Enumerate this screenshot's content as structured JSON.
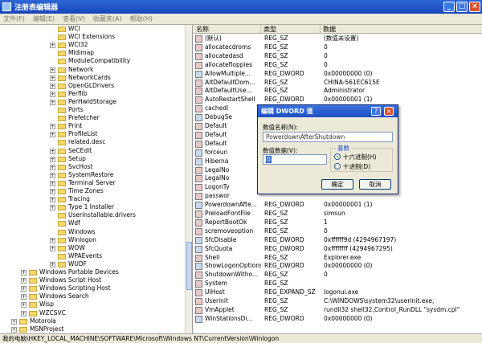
{
  "window": {
    "title": "注册表编辑器"
  },
  "menu": [
    "文件(F)",
    "编辑(E)",
    "查看(V)",
    "收藏夹(A)",
    "帮助(H)"
  ],
  "tree": [
    {
      "label": "WCI",
      "indent": 6,
      "exp": ""
    },
    {
      "label": "WCI Extensions",
      "indent": 6,
      "exp": ""
    },
    {
      "label": "WCI32",
      "indent": 6,
      "exp": "+"
    },
    {
      "label": "Midimap",
      "indent": 6,
      "exp": ""
    },
    {
      "label": "ModuleCompatibility",
      "indent": 6,
      "exp": ""
    },
    {
      "label": "Network",
      "indent": 6,
      "exp": "+"
    },
    {
      "label": "NetworkCards",
      "indent": 6,
      "exp": "+"
    },
    {
      "label": "OpenGLDrivers",
      "indent": 6,
      "exp": "+"
    },
    {
      "label": "Perflib",
      "indent": 6,
      "exp": "+"
    },
    {
      "label": "PerHwIdStorage",
      "indent": 6,
      "exp": "+"
    },
    {
      "label": "Ports",
      "indent": 6,
      "exp": ""
    },
    {
      "label": "Prefetcher",
      "indent": 6,
      "exp": ""
    },
    {
      "label": "Print",
      "indent": 6,
      "exp": "+"
    },
    {
      "label": "ProfileList",
      "indent": 6,
      "exp": "+"
    },
    {
      "label": "related.desc",
      "indent": 6,
      "exp": ""
    },
    {
      "label": "SeCEdit",
      "indent": 6,
      "exp": "+"
    },
    {
      "label": "Setup",
      "indent": 6,
      "exp": "+"
    },
    {
      "label": "SvcHost",
      "indent": 6,
      "exp": "+"
    },
    {
      "label": "SystemRestore",
      "indent": 6,
      "exp": "+"
    },
    {
      "label": "Terminal Server",
      "indent": 6,
      "exp": "+"
    },
    {
      "label": "Time Zones",
      "indent": 6,
      "exp": "+"
    },
    {
      "label": "Tracing",
      "indent": 6,
      "exp": "+"
    },
    {
      "label": "Type 1 Installer",
      "indent": 6,
      "exp": "+"
    },
    {
      "label": "Userinstallable.drivers",
      "indent": 6,
      "exp": ""
    },
    {
      "label": "Wdf",
      "indent": 6,
      "exp": ""
    },
    {
      "label": "Windows",
      "indent": 6,
      "exp": ""
    },
    {
      "label": "Winlogon",
      "indent": 6,
      "exp": "+"
    },
    {
      "label": "WOW",
      "indent": 6,
      "exp": "+"
    },
    {
      "label": "WPAEvents",
      "indent": 6,
      "exp": ""
    },
    {
      "label": "WUDF",
      "indent": 6,
      "exp": "+"
    },
    {
      "label": "Windows Portable Devices",
      "indent": 3,
      "exp": "+"
    },
    {
      "label": "Windows Script Host",
      "indent": 3,
      "exp": "+"
    },
    {
      "label": "Windows Scripting Host",
      "indent": 3,
      "exp": "+"
    },
    {
      "label": "Windows Search",
      "indent": 3,
      "exp": "+"
    },
    {
      "label": "Wisp",
      "indent": 3,
      "exp": "+"
    },
    {
      "label": "WZCSVC",
      "indent": 3,
      "exp": "+"
    },
    {
      "label": "Motorola",
      "indent": 2,
      "exp": "+"
    },
    {
      "label": "MSNProject",
      "indent": 2,
      "exp": "+"
    }
  ],
  "list_headers": [
    "名称",
    "类型",
    "数据"
  ],
  "values": [
    {
      "icon": "ab",
      "name": "(默认)",
      "type": "REG_SZ",
      "data": "(数值未设置)"
    },
    {
      "icon": "ab",
      "name": "allocatecdroms",
      "type": "REG_SZ",
      "data": "0"
    },
    {
      "icon": "ab",
      "name": "allocatedasd",
      "type": "REG_SZ",
      "data": "0"
    },
    {
      "icon": "ab",
      "name": "allocatefloppies",
      "type": "REG_SZ",
      "data": "0"
    },
    {
      "icon": "bin",
      "name": "AllowMultiple...",
      "type": "REG_DWORD",
      "data": "0x00000000 (0)"
    },
    {
      "icon": "ab",
      "name": "AltDefaultDom...",
      "type": "REG_SZ",
      "data": "CHINA-561EC615E"
    },
    {
      "icon": "ab",
      "name": "AltDefaultUse...",
      "type": "REG_SZ",
      "data": "Administrator"
    },
    {
      "icon": "ab",
      "name": "AutoRestartShell",
      "type": "REG_DWORD",
      "data": "0x00000001 (1)"
    },
    {
      "icon": "ab",
      "name": "cachedl",
      "type": "",
      "data": ""
    },
    {
      "icon": "bin",
      "name": "DebugSe",
      "type": "",
      "data": ""
    },
    {
      "icon": "ab",
      "name": "Default",
      "type": "",
      "data": ""
    },
    {
      "icon": "ab",
      "name": "Default",
      "type": "",
      "data": ""
    },
    {
      "icon": "ab",
      "name": "Default",
      "type": "",
      "data": ""
    },
    {
      "icon": "bin",
      "name": "forceun",
      "type": "",
      "data": ""
    },
    {
      "icon": "bin",
      "name": "Hiberna",
      "type": "",
      "data": ""
    },
    {
      "icon": "ab",
      "name": "LegalNo",
      "type": "",
      "data": ""
    },
    {
      "icon": "ab",
      "name": "LegalNo",
      "type": "",
      "data": ""
    },
    {
      "icon": "ab",
      "name": "LogonTy",
      "type": "",
      "data": ""
    },
    {
      "icon": "ab",
      "name": "passwor",
      "type": "",
      "data": ""
    },
    {
      "icon": "bin",
      "name": "PowerdownAfte...",
      "type": "REG_DWORD",
      "data": "0x00000001 (1)"
    },
    {
      "icon": "ab",
      "name": "PreloadFontFile",
      "type": "REG_SZ",
      "data": "simsun"
    },
    {
      "icon": "ab",
      "name": "ReportBootOk",
      "type": "REG_SZ",
      "data": "1"
    },
    {
      "icon": "ab",
      "name": "scremoveoption",
      "type": "REG_SZ",
      "data": "0"
    },
    {
      "icon": "bin",
      "name": "SfcDisable",
      "type": "REG_DWORD",
      "data": "0xffffff9d (4294967197)"
    },
    {
      "icon": "bin",
      "name": "SfcQuota",
      "type": "REG_DWORD",
      "data": "0xffffffff (4294967295)"
    },
    {
      "icon": "ab",
      "name": "Shell",
      "type": "REG_SZ",
      "data": "Explorer.exe"
    },
    {
      "icon": "bin",
      "name": "ShowLogonOptions",
      "type": "REG_DWORD",
      "data": "0x00000000 (0)"
    },
    {
      "icon": "ab",
      "name": "ShutdownWitho...",
      "type": "REG_SZ",
      "data": "0"
    },
    {
      "icon": "ab",
      "name": "System",
      "type": "REG_SZ",
      "data": ""
    },
    {
      "icon": "ab",
      "name": "UIHost",
      "type": "REG_EXPAND_SZ",
      "data": "logonui.exe"
    },
    {
      "icon": "ab",
      "name": "Userinit",
      "type": "REG_SZ",
      "data": "C:\\WINDOWS\\system32\\userinit.exe,"
    },
    {
      "icon": "ab",
      "name": "VmApplet",
      "type": "REG_SZ",
      "data": "rundll32 shell32,Control_RunDLL \"sysdm.cpl\""
    },
    {
      "icon": "bin",
      "name": "WinStationsDi...",
      "type": "REG_DWORD",
      "data": "0x00000000 (0)"
    }
  ],
  "status": "我的电脑\\HKEY_LOCAL_MACHINE\\SOFTWARE\\Microsoft\\Windows NT\\CurrentVersion\\Winlogon",
  "dialog": {
    "title": "编辑 DWORD 值",
    "name_label": "数值名称(N):",
    "name_value": "PowerdownAfterShutdown",
    "data_label": "数值数据(V):",
    "data_value": "0",
    "base_label": "基数",
    "hex_label": "十六进制(H)",
    "dec_label": "十进制(D)",
    "ok": "确定",
    "cancel": "取消"
  }
}
